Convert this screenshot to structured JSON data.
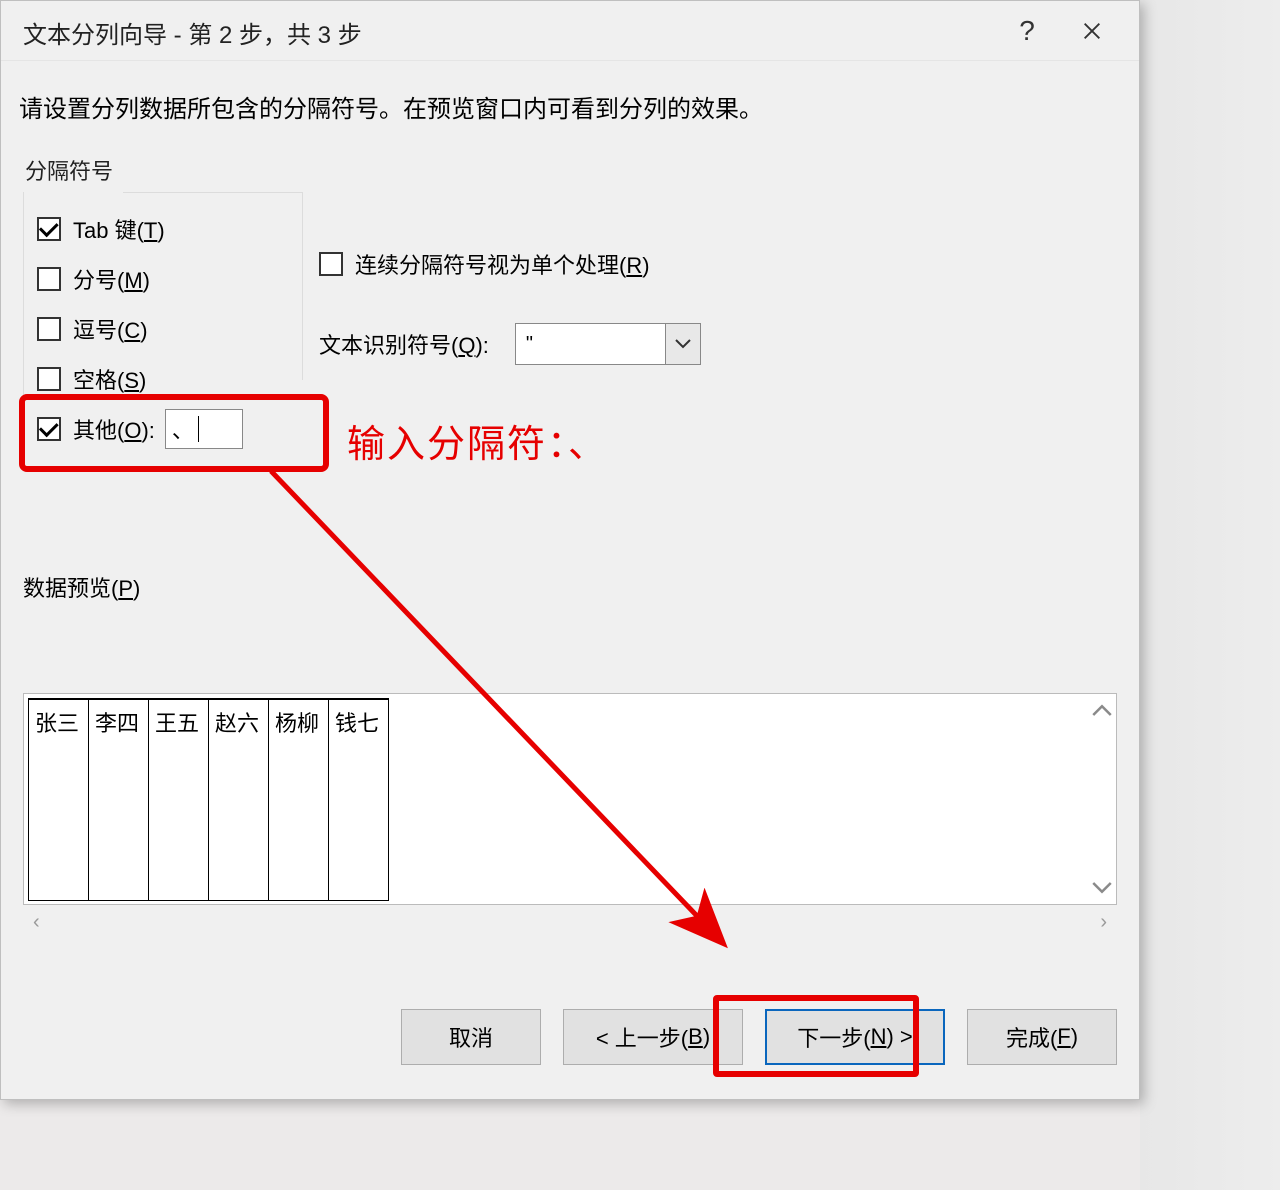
{
  "title": "文本分列向导 - 第 2 步，共 3 步",
  "instruction": "请设置分列数据所包含的分隔符号。在预览窗口内可看到分列的效果。",
  "delimiters": {
    "group_label": "分隔符号",
    "tab": {
      "label_pre": "Tab 键(",
      "mn": "T",
      "label_post": ")",
      "checked": true
    },
    "semicolon": {
      "label_pre": "分号(",
      "mn": "M",
      "label_post": ")",
      "checked": false
    },
    "comma": {
      "label_pre": "逗号(",
      "mn": "C",
      "label_post": ")",
      "checked": false
    },
    "space": {
      "label_pre": "空格(",
      "mn": "S",
      "label_post": ")",
      "checked": false
    },
    "other": {
      "label_pre": "其他(",
      "mn": "O",
      "label_post": "):",
      "checked": true,
      "value": "、"
    }
  },
  "consecutive": {
    "label_pre": "连续分隔符号视为单个处理(",
    "mn": "R",
    "label_post": ")",
    "checked": false
  },
  "qualifier": {
    "label_pre": "文本识别符号(",
    "mn": "Q",
    "label_post": "):",
    "value": "\""
  },
  "annotation": "输入分隔符：、",
  "preview": {
    "label_pre": "数据预览(",
    "mn": "P",
    "label_post": ")",
    "columns": [
      "张三",
      "李四",
      "王五",
      "赵六",
      "杨柳",
      "钱七"
    ]
  },
  "buttons": {
    "cancel": "取消",
    "back_pre": "< 上一步(",
    "back_mn": "B",
    "back_post": ")",
    "next_pre": "下一步(",
    "next_mn": "N",
    "next_post": ") >",
    "finish_pre": "完成(",
    "finish_mn": "F",
    "finish_post": ")"
  }
}
